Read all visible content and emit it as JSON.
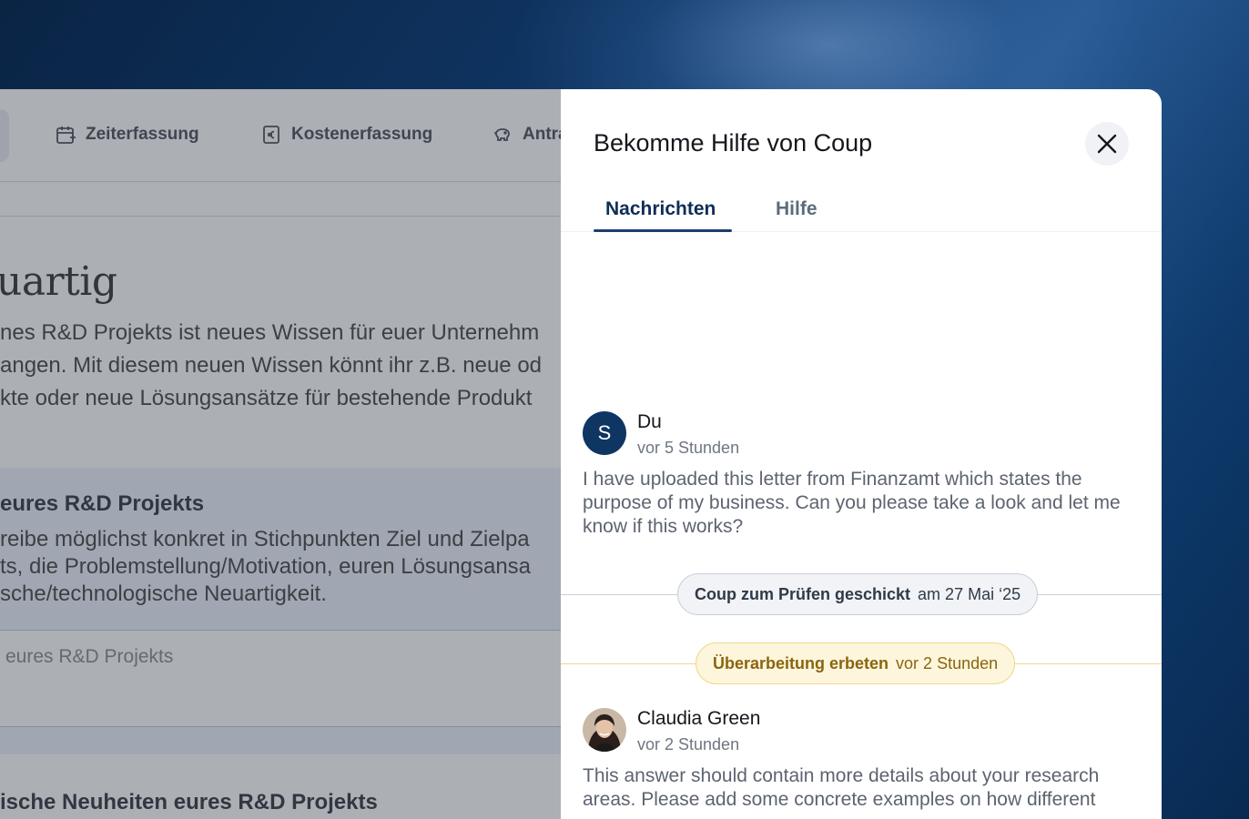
{
  "background_app": {
    "nav": [
      {
        "label": "Zeiterfassung",
        "icon": "calendar-plus-icon"
      },
      {
        "label": "Kostenerfassung",
        "icon": "euro-receipt-icon"
      },
      {
        "label": "Antra",
        "icon": "piggy-bank-icon"
      }
    ],
    "heading": "uartig",
    "paragraph_lines": [
      "nes R&D Projekts ist neues Wissen für euer Unternehm",
      "angen. Mit diesem neuen Wissen könnt ihr z.B. neue od",
      "kte oder neue Lösungsansätze für bestehende Produkt"
    ],
    "card_title": "eures R&D Projekts",
    "card_lines": [
      "reibe möglichst konkret in Stichpunkten Ziel und Zielpa",
      "ts, die Problemstellung/Motivation, euren Lösungsansa",
      "sche/technologische Neuartigkeit."
    ],
    "input_placeholder": "eures R&D Projekts",
    "bottom_title": "ische Neuheiten eures R&D Projekts"
  },
  "panel": {
    "title": "Bekomme Hilfe von Coup",
    "close_icon": "close-icon",
    "tabs": [
      {
        "label": "Nachrichten",
        "active": true
      },
      {
        "label": "Hilfe",
        "active": false
      }
    ],
    "messages": [
      {
        "initial": "S",
        "name": "Du",
        "time": "vor 5 Stunden",
        "text": "I have uploaded this letter from Finanzamt which states the purpose of my business. Can you please take a look and let me know if this works?"
      },
      {
        "name": "Claudia Green",
        "time": "vor 2 Stunden",
        "text": "This answer should contain more details about your research areas. Please add some concrete examples on how different"
      }
    ],
    "events": [
      {
        "label": "Coup zum Prüfen geschickt",
        "time": "am 27 Mai ‘25",
        "color": "#e9ecf0",
        "border": "#c9cfd7",
        "text_color": "#2f3a48"
      },
      {
        "label": "Überarbeitung erbeten",
        "time": "vor 2 Stunden",
        "color": "#fdf6dc",
        "border": "#f0d88a",
        "text_color": "#8a6510"
      }
    ]
  }
}
